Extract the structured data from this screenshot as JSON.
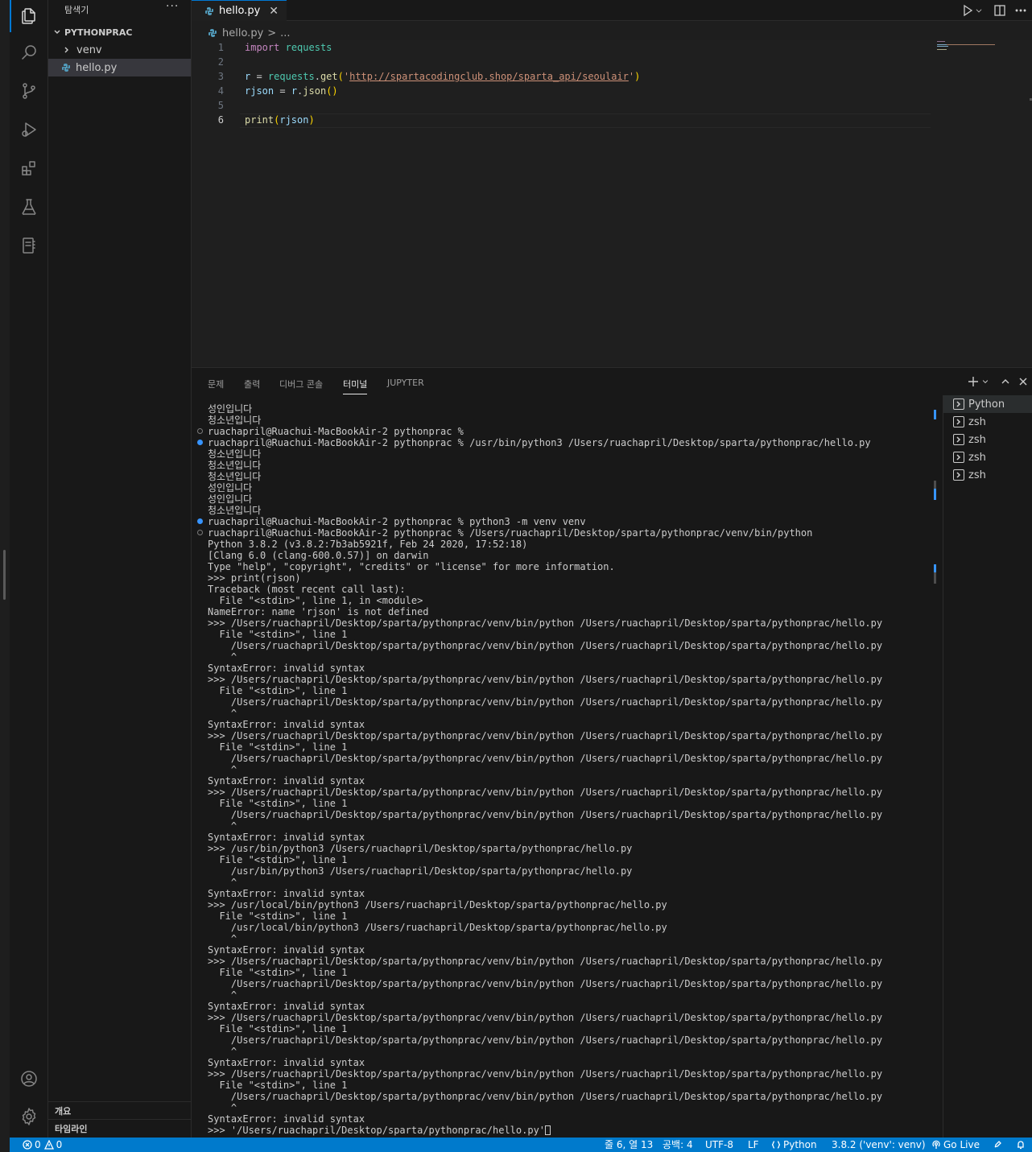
{
  "sidebar": {
    "title": "탐색기",
    "more": "···",
    "folder": "PYTHONPRAC",
    "items": [
      {
        "label": "venv"
      },
      {
        "label": "hello.py"
      }
    ],
    "outline": "개요",
    "timeline": "타임라인"
  },
  "tabs": [
    {
      "label": "hello.py",
      "close": "✕"
    }
  ],
  "breadcrumb": {
    "file": "hello.py",
    "sep": ">",
    "rest": "..."
  },
  "editor": {
    "line_numbers": [
      "1",
      "2",
      "3",
      "4",
      "5",
      "6"
    ],
    "current_line": "6",
    "code": {
      "l1_import": "import",
      "l1_module": "requests",
      "l3_var": "r",
      "l3_eq": " = ",
      "l3_obj": "requests",
      "l3_dot": ".",
      "l3_fn": "get",
      "l3_open": "(",
      "l3_q1": "'",
      "l3_url": "http://spartacodingclub.shop/sparta_api/seoulair",
      "l3_q2": "'",
      "l3_close": ")",
      "l4_var": "rjson",
      "l4_eq": " = ",
      "l4_obj": "r",
      "l4_dot": ".",
      "l4_fn": "json",
      "l4_parens": "()",
      "l6_fn": "print",
      "l6_open": "(",
      "l6_arg": "rjson",
      "l6_close": ")"
    }
  },
  "panel": {
    "tabs": [
      "문제",
      "출력",
      "디버그 콘솔",
      "터미널",
      "JUPYTER"
    ],
    "active_tab": "터미널"
  },
  "terminal": {
    "lines": [
      "성인입니다",
      "청소년입니다",
      "ruachapril@Ruachui-MacBookAir-2 pythonprac % ",
      "ruachapril@Ruachui-MacBookAir-2 pythonprac % /usr/bin/python3 /Users/ruachapril/Desktop/sparta/pythonprac/hello.py",
      "청소년입니다",
      "청소년입니다",
      "청소년입니다",
      "성인입니다",
      "성인입니다",
      "청소년입니다",
      "ruachapril@Ruachui-MacBookAir-2 pythonprac % python3 -m venv venv",
      "ruachapril@Ruachui-MacBookAir-2 pythonprac % /Users/ruachapril/Desktop/sparta/pythonprac/venv/bin/python",
      "Python 3.8.2 (v3.8.2:7b3ab5921f, Feb 24 2020, 17:52:18) ",
      "[Clang 6.0 (clang-600.0.57)] on darwin",
      "Type \"help\", \"copyright\", \"credits\" or \"license\" for more information.",
      ">>> print(rjson)",
      "Traceback (most recent call last):",
      "  File \"<stdin>\", line 1, in <module>",
      "NameError: name 'rjson' is not defined",
      ">>> /Users/ruachapril/Desktop/sparta/pythonprac/venv/bin/python /Users/ruachapril/Desktop/sparta/pythonprac/hello.py",
      "  File \"<stdin>\", line 1",
      "    /Users/ruachapril/Desktop/sparta/pythonprac/venv/bin/python /Users/ruachapril/Desktop/sparta/pythonprac/hello.py",
      "    ^",
      "SyntaxError: invalid syntax",
      ">>> /Users/ruachapril/Desktop/sparta/pythonprac/venv/bin/python /Users/ruachapril/Desktop/sparta/pythonprac/hello.py",
      "  File \"<stdin>\", line 1",
      "    /Users/ruachapril/Desktop/sparta/pythonprac/venv/bin/python /Users/ruachapril/Desktop/sparta/pythonprac/hello.py",
      "    ^",
      "SyntaxError: invalid syntax",
      ">>> /Users/ruachapril/Desktop/sparta/pythonprac/venv/bin/python /Users/ruachapril/Desktop/sparta/pythonprac/hello.py",
      "  File \"<stdin>\", line 1",
      "    /Users/ruachapril/Desktop/sparta/pythonprac/venv/bin/python /Users/ruachapril/Desktop/sparta/pythonprac/hello.py",
      "    ^",
      "SyntaxError: invalid syntax",
      ">>> /Users/ruachapril/Desktop/sparta/pythonprac/venv/bin/python /Users/ruachapril/Desktop/sparta/pythonprac/hello.py",
      "  File \"<stdin>\", line 1",
      "    /Users/ruachapril/Desktop/sparta/pythonprac/venv/bin/python /Users/ruachapril/Desktop/sparta/pythonprac/hello.py",
      "    ^",
      "SyntaxError: invalid syntax",
      ">>> /usr/bin/python3 /Users/ruachapril/Desktop/sparta/pythonprac/hello.py",
      "  File \"<stdin>\", line 1",
      "    /usr/bin/python3 /Users/ruachapril/Desktop/sparta/pythonprac/hello.py",
      "    ^",
      "SyntaxError: invalid syntax",
      ">>> /usr/local/bin/python3 /Users/ruachapril/Desktop/sparta/pythonprac/hello.py",
      "  File \"<stdin>\", line 1",
      "    /usr/local/bin/python3 /Users/ruachapril/Desktop/sparta/pythonprac/hello.py",
      "    ^",
      "SyntaxError: invalid syntax",
      ">>> /Users/ruachapril/Desktop/sparta/pythonprac/venv/bin/python /Users/ruachapril/Desktop/sparta/pythonprac/hello.py",
      "  File \"<stdin>\", line 1",
      "    /Users/ruachapril/Desktop/sparta/pythonprac/venv/bin/python /Users/ruachapril/Desktop/sparta/pythonprac/hello.py",
      "    ^",
      "SyntaxError: invalid syntax",
      ">>> /Users/ruachapril/Desktop/sparta/pythonprac/venv/bin/python /Users/ruachapril/Desktop/sparta/pythonprac/hello.py",
      "  File \"<stdin>\", line 1",
      "    /Users/ruachapril/Desktop/sparta/pythonprac/venv/bin/python /Users/ruachapril/Desktop/sparta/pythonprac/hello.py",
      "    ^",
      "SyntaxError: invalid syntax",
      ">>> /Users/ruachapril/Desktop/sparta/pythonprac/venv/bin/python /Users/ruachapril/Desktop/sparta/pythonprac/hello.py",
      "  File \"<stdin>\", line 1",
      "    /Users/ruachapril/Desktop/sparta/pythonprac/venv/bin/python /Users/ruachapril/Desktop/sparta/pythonprac/hello.py",
      "    ^",
      "SyntaxError: invalid syntax",
      ">>> '/Users/ruachapril/Desktop/sparta/pythonprac/hello.py'"
    ],
    "sessions": [
      {
        "label": "Python"
      },
      {
        "label": "zsh"
      },
      {
        "label": "zsh"
      },
      {
        "label": "zsh"
      },
      {
        "label": "zsh"
      }
    ]
  },
  "statusbar": {
    "errors": "0",
    "warnings": "0",
    "position": "줄 6, 열 13",
    "spaces": "공백: 4",
    "encoding": "UTF-8",
    "eol": "LF",
    "language": "Python",
    "interpreter": "3.8.2 ('venv': venv)",
    "golive": "Go Live"
  },
  "colors": {
    "accent": "#007acc",
    "keyword": "#c586c0",
    "string": "#ce9178",
    "function": "#dcdcaa",
    "variable": "#9cdcfe"
  }
}
